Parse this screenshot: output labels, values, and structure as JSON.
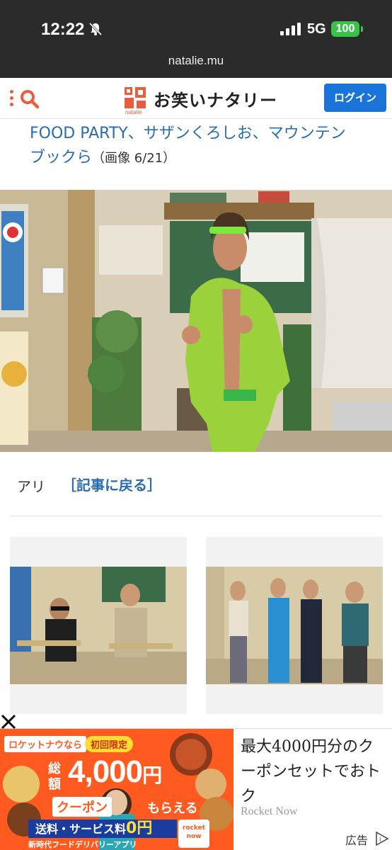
{
  "status_bar": {
    "time": "12:22",
    "network": "5G",
    "battery": "100",
    "url": "natalie.mu"
  },
  "header": {
    "logo_sub": "natalie",
    "logo_text": "お笑いナタリー",
    "login_label": "ログイン",
    "accent_color": "#e85d3f",
    "login_color": "#1a73d9"
  },
  "article": {
    "title_line1": "FOOD PARTY、サザンくろしお、マウンテン",
    "title_line2": "ブックら",
    "image_counter": "（画像 6/21）",
    "caption": "アリ",
    "back_link": "［記事に戻る］"
  },
  "thumbnails": {
    "left_partial": "",
    "right_partial": ""
  },
  "ad": {
    "banner_tag": "ロケットナウなら",
    "banner_limited": "初回限定",
    "banner_total": "総額",
    "banner_amount": "4,000",
    "banner_yen": "円",
    "banner_coupon": "クーポン",
    "banner_get": "もらえる",
    "banner_fee": "送料・サービス料",
    "banner_fee_zero": "0円",
    "banner_footer": "新時代フードデリバリーアプリ",
    "banner_brand_mark": "rocket now",
    "headline": "最大4000円分のクーポンセットでおトク",
    "brand": "Rocket Now",
    "label": "広告"
  }
}
